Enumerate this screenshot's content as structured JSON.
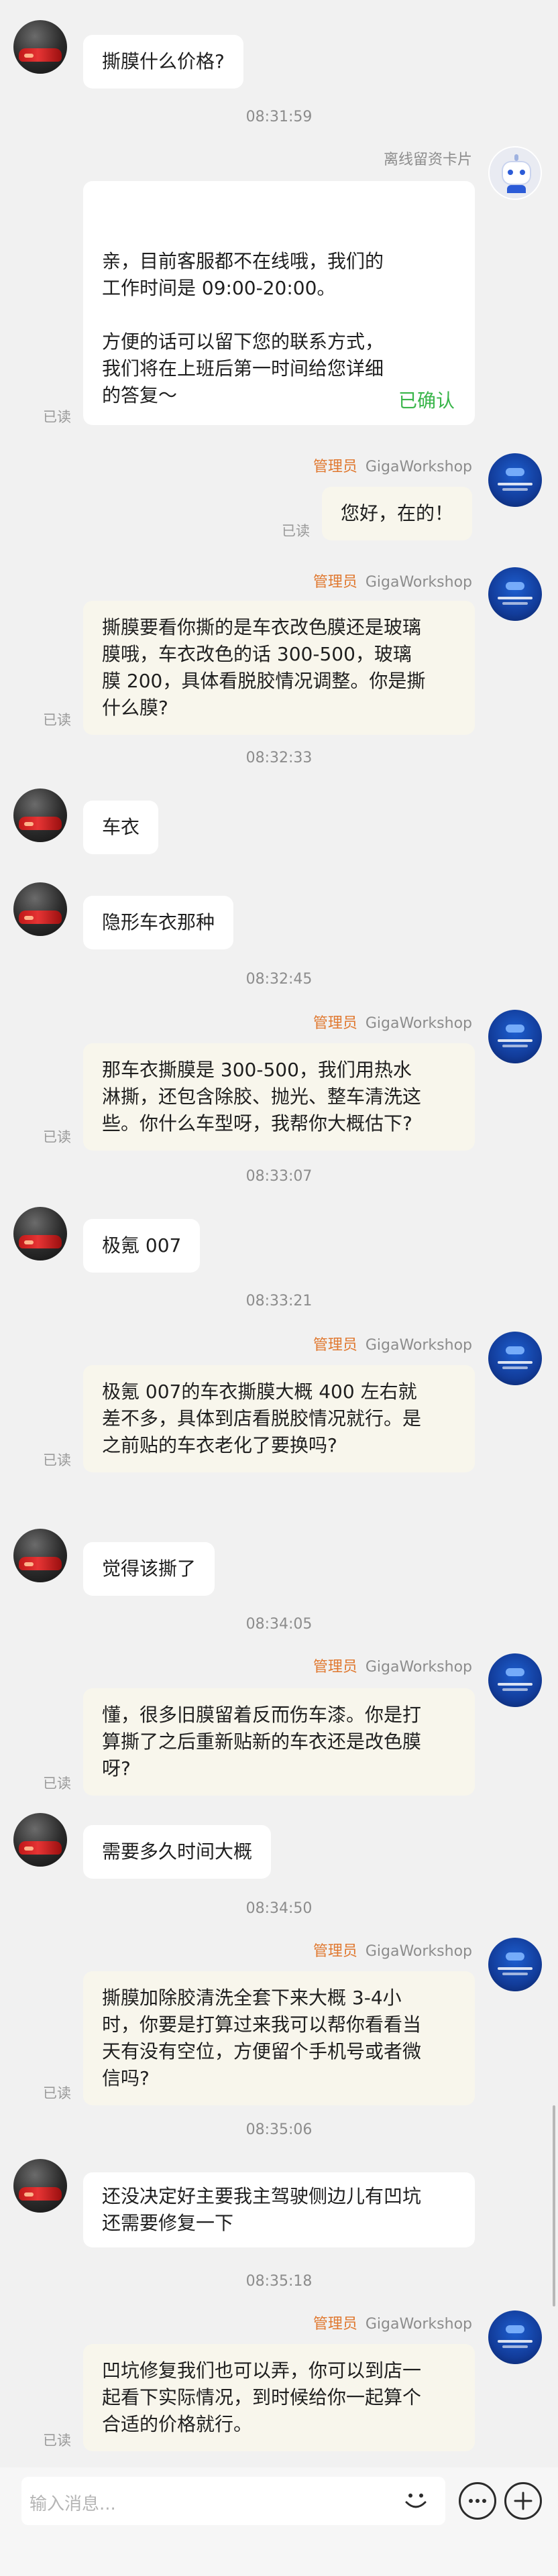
{
  "messages": [
    {
      "type": "customer",
      "text": "撕膜什么价格?"
    },
    {
      "type": "time",
      "text": "08:31:59"
    },
    {
      "type": "bot",
      "sender": "离线留资卡片",
      "text": "亲，目前客服都不在线哦，我们的\n工作时间是 09:00-20:00。\n\n方便的话可以留下您的联系方式，\n我们将在上班后第一时间给您详细\n的答复～",
      "confirm": "已确认",
      "read": "已读"
    },
    {
      "type": "staff",
      "role": "管理员",
      "sender": "GigaWorkshop",
      "text": "您好，在的！",
      "read": "已读"
    },
    {
      "type": "staff",
      "role": "管理员",
      "sender": "GigaWorkshop",
      "text": "撕膜要看你撕的是车衣改色膜还是玻璃\n膜哦，车衣改色的话 300-500，玻璃\n膜 200，具体看脱胶情况调整。你是撕\n什么膜?",
      "read": "已读"
    },
    {
      "type": "time",
      "text": "08:32:33"
    },
    {
      "type": "customer",
      "text": "车衣"
    },
    {
      "type": "customer",
      "text": "隐形车衣那种"
    },
    {
      "type": "time",
      "text": "08:32:45"
    },
    {
      "type": "staff",
      "role": "管理员",
      "sender": "GigaWorkshop",
      "text": "那车衣撕膜是 300-500，我们用热水\n淋撕，还包含除胶、抛光、整车清洗这\n些。你什么车型呀，我帮你大概估下?",
      "read": "已读"
    },
    {
      "type": "time",
      "text": "08:33:07"
    },
    {
      "type": "customer",
      "text": "极氪 007"
    },
    {
      "type": "time",
      "text": "08:33:21"
    },
    {
      "type": "staff",
      "role": "管理员",
      "sender": "GigaWorkshop",
      "text": "极氪 007的车衣撕膜大概 400 左右就\n差不多，具体到店看脱胶情况就行。是\n之前贴的车衣老化了要换吗?",
      "read": "已读"
    },
    {
      "type": "customer",
      "text": "觉得该撕了"
    },
    {
      "type": "time",
      "text": "08:34:05"
    },
    {
      "type": "staff",
      "role": "管理员",
      "sender": "GigaWorkshop",
      "text": "懂，很多旧膜留着反而伤车漆。你是打\n算撕了之后重新贴新的车衣还是改色膜\n呀?",
      "read": "已读"
    },
    {
      "type": "customer",
      "text": "需要多久时间大概"
    },
    {
      "type": "time",
      "text": "08:34:50"
    },
    {
      "type": "staff",
      "role": "管理员",
      "sender": "GigaWorkshop",
      "text": "撕膜加除胶清洗全套下来大概 3-4小\n时，你要是打算过来我可以帮你看看当\n天有没有空位，方便留个手机号或者微\n信吗?",
      "read": "已读"
    },
    {
      "type": "time",
      "text": "08:35:06"
    },
    {
      "type": "customer",
      "text": "还没决定好主要我主驾驶侧边儿有凹坑\n还需要修复一下"
    },
    {
      "type": "time",
      "text": "08:35:18"
    },
    {
      "type": "staff",
      "role": "管理员",
      "sender": "GigaWorkshop",
      "text": "凹坑修复我们也可以弄，你可以到店一\n起看下实际情况，到时候给你一起算个\n合适的价格就行。",
      "read": "已读"
    }
  ],
  "input": {
    "placeholder": "输入消息..."
  },
  "colors": {
    "background": "#f1f1f1",
    "staff_bubble": "#f8f6ec",
    "customer_bubble": "#ffffff",
    "role": "#e0782f",
    "confirm": "#39b54a"
  }
}
